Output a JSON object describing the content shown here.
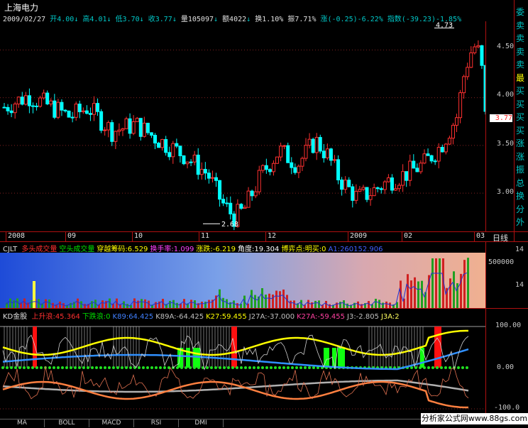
{
  "stock_name": "上海电力",
  "bell_icon": "bell-icon",
  "quote_line": {
    "date": "2009/02/27",
    "open": "开4.00",
    "high": "高4.01",
    "low": "低3.70",
    "close": "收3.77",
    "volume": "量105097",
    "amount": "额4022",
    "turnover": "换1.10%",
    "amplitude": "振7.71%",
    "change": "涨(-0.25)-6.22%",
    "index": "指数(-39.23)-1.85%"
  },
  "price_axis": [
    "4.50",
    "4.00",
    "3.50",
    "3.00"
  ],
  "current_price": "3.77",
  "high_mark": "4.73",
  "low_mark": "2.68",
  "date_axis": [
    "2008",
    "09",
    "10",
    "11",
    "12",
    "2009",
    "02",
    "03"
  ],
  "line_button": "日线",
  "right_panel": [
    "委",
    "卖",
    "卖",
    "卖",
    "卖",
    "最",
    "买",
    "买",
    "买",
    "买",
    "涨",
    "涨",
    "振",
    "总",
    "换",
    "分",
    "外"
  ],
  "vol_panel": {
    "name": "CJLT",
    "indicators": [
      {
        "text": "多头成交量",
        "color": "#ff3030"
      },
      {
        "text": "空头成交量",
        "color": "#00e000"
      },
      {
        "text": "穿越筹码:6.529",
        "color": "#ffff00"
      },
      {
        "text": "换手率:1.099",
        "color": "#ff40ff"
      },
      {
        "text": "涨跌:-6.219",
        "color": "#ffff00"
      },
      {
        "text": "角度:19.304",
        "color": "#ffffff"
      },
      {
        "text": "博弈点:明买:0",
        "color": "#ffff00"
      },
      {
        "text": "A1:260152.906",
        "color": "#4060ff"
      }
    ],
    "axis": [
      "14",
      "500000",
      "14"
    ]
  },
  "kd_panel": {
    "name": "KD金股",
    "indicators": [
      {
        "text": "上升浪:45.364",
        "color": "#ff3030"
      },
      {
        "text": "下跌浪:0",
        "color": "#00e000"
      },
      {
        "text": "K89:64.425",
        "color": "#4080ff"
      },
      {
        "text": "K89A:-64.425",
        "color": "#c0c0c0"
      },
      {
        "text": "K27:59.455",
        "color": "#ffff00"
      },
      {
        "text": "J27A:-37.000",
        "color": "#c0c0c0"
      },
      {
        "text": "K27A:-59.455",
        "color": "#ff40a0"
      },
      {
        "text": "J3:-2.805",
        "color": "#c0c0c0"
      },
      {
        "text": "J3A:2",
        "color": "#ffff60"
      }
    ],
    "axis": [
      "100.00",
      "0.00",
      "-100.0"
    ]
  },
  "tabs": [
    "MA",
    "BOLL",
    "MACD",
    "RSI",
    "DMI"
  ],
  "watermark": "分析家公式网www.88gs.com",
  "colors": {
    "up": "#ff3030",
    "down": "#00c8c8",
    "frame": "#b01010",
    "bg": "#000000"
  },
  "chart_data": {
    "type": "candlestick",
    "title": "上海电力",
    "x_range": [
      "2008-08",
      "2009-03"
    ],
    "ylim": [
      2.6,
      4.8
    ],
    "high": 4.73,
    "low": 2.68,
    "last_close": 3.77
  }
}
